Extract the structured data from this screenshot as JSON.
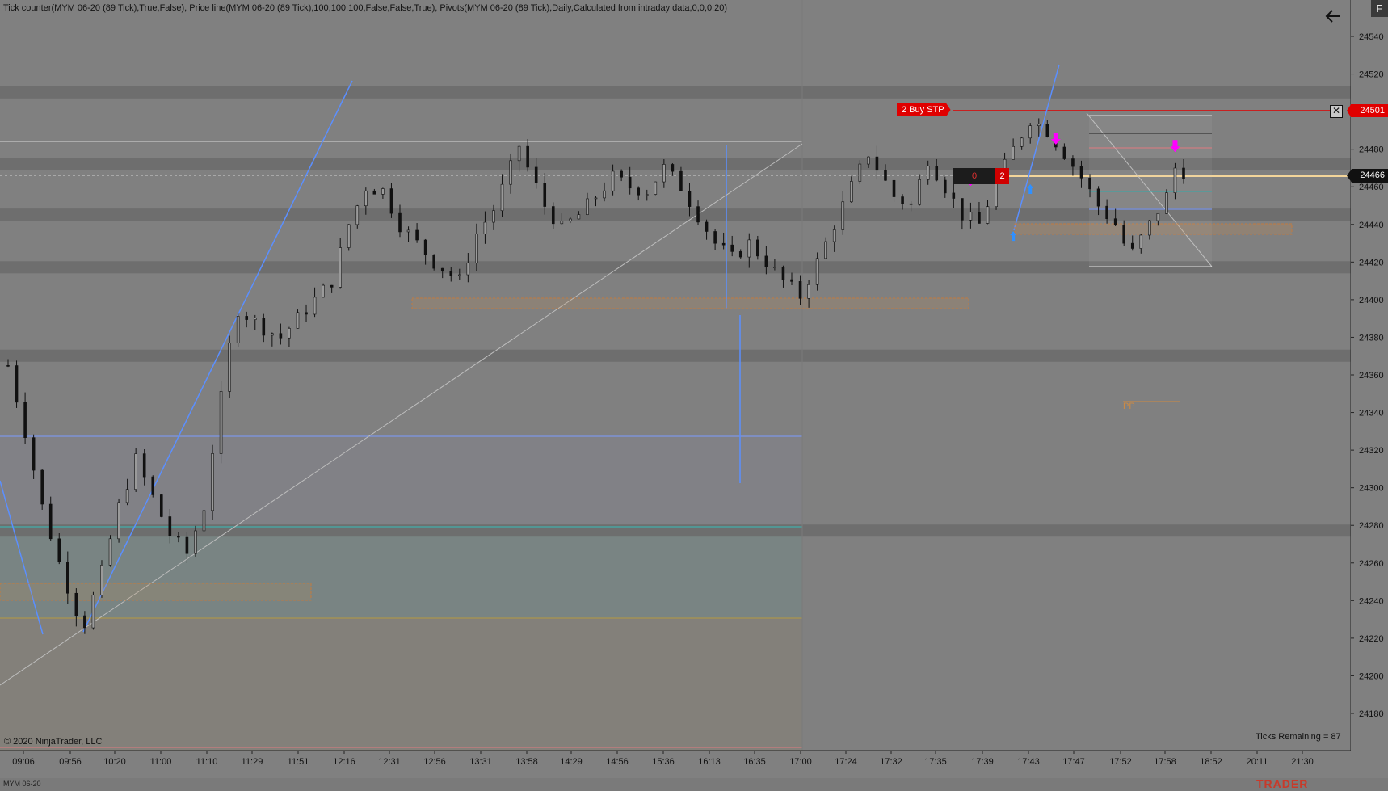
{
  "indicator_text": "Tick counter(MYM 06-20 (89 Tick),True,False), Price line(MYM 06-20 (89 Tick),100,100,100,False,False,True), Pivots(MYM 06-20 (89 Tick),Daily,Calculated from intraday data,0,0,0,20)",
  "f_button": "F",
  "copyright": "© 2020 NinjaTrader, LLC",
  "ticks_remaining": "Ticks Remaining = 87",
  "instrument_label": "MYM 06-20",
  "brand": "TRADER",
  "icons": {
    "back": "back-arrow-icon",
    "close": "close-x-icon"
  },
  "order": {
    "buy_stp_label": "2  Buy STP",
    "buy_stp_price": "24501",
    "position_left": "0",
    "position_qty": "2",
    "last_price": "24466"
  },
  "pivot_label": "PP",
  "colors": {
    "background": "#808080",
    "band_dark": "#6c6c6c",
    "buy_stop": "#e00000",
    "trend_line": "#5b8fff",
    "last_price_line": "#f3d59a",
    "pivot": "#d08a40",
    "signal_magenta": "#ff00ff",
    "signal_blue": "#3090ff"
  },
  "chart_data": {
    "type": "candlestick",
    "ylim": [
      24170,
      24550
    ],
    "y_ticks": [
      24540,
      24520,
      24500,
      24480,
      24460,
      24440,
      24420,
      24400,
      24380,
      24360,
      24340,
      24320,
      24300,
      24280,
      24260,
      24240,
      24220,
      24200,
      24180
    ],
    "x_ticks": [
      "09:06",
      "09:56",
      "10:20",
      "11:00",
      "11:10",
      "11:29",
      "11:51",
      "12:16",
      "12:31",
      "12:56",
      "13:31",
      "13:58",
      "14:29",
      "14:56",
      "15:36",
      "16:13",
      "16:35",
      "17:00",
      "17:24",
      "17:32",
      "17:35",
      "17:39",
      "17:43",
      "17:47",
      "17:52",
      "17:58",
      "18:52",
      "20:11",
      "21:30"
    ],
    "grid": false,
    "price_path": [
      [
        0,
        24365
      ],
      [
        2,
        24330
      ],
      [
        4,
        24290
      ],
      [
        6,
        24260
      ],
      [
        8,
        24235
      ],
      [
        9,
        24228
      ],
      [
        11,
        24255
      ],
      [
        13,
        24290
      ],
      [
        15,
        24315
      ],
      [
        17,
        24295
      ],
      [
        19,
        24275
      ],
      [
        21,
        24265
      ],
      [
        23,
        24290
      ],
      [
        24,
        24320
      ],
      [
        26,
        24375
      ],
      [
        27,
        24395
      ],
      [
        30,
        24385
      ],
      [
        32,
        24380
      ],
      [
        34,
        24390
      ],
      [
        36,
        24400
      ],
      [
        38,
        24410
      ],
      [
        40,
        24440
      ],
      [
        42,
        24460
      ],
      [
        44,
        24458
      ],
      [
        46,
        24440
      ],
      [
        48,
        24430
      ],
      [
        50,
        24420
      ],
      [
        53,
        24410
      ],
      [
        55,
        24435
      ],
      [
        57,
        24448
      ],
      [
        59,
        24470
      ],
      [
        60,
        24482
      ],
      [
        61,
        24470
      ],
      [
        63,
        24450
      ],
      [
        65,
        24438
      ],
      [
        67,
        24445
      ],
      [
        69,
        24455
      ],
      [
        71,
        24465
      ],
      [
        73,
        24460
      ],
      [
        75,
        24458
      ],
      [
        77,
        24470
      ],
      [
        79,
        24460
      ],
      [
        81,
        24445
      ],
      [
        83,
        24430
      ],
      [
        85,
        24422
      ],
      [
        87,
        24430
      ],
      [
        89,
        24420
      ],
      [
        91,
        24410
      ],
      [
        93,
        24402
      ],
      [
        95,
        24420
      ],
      [
        97,
        24440
      ],
      [
        99,
        24460
      ],
      [
        101,
        24478
      ],
      [
        102,
        24470
      ],
      [
        104,
        24455
      ],
      [
        106,
        24450
      ],
      [
        108,
        24475
      ],
      [
        110,
        24460
      ],
      [
        112,
        24445
      ],
      [
        114,
        24440
      ],
      [
        116,
        24462
      ],
      [
        118,
        24480
      ],
      [
        120,
        24496
      ],
      [
        122,
        24490
      ],
      [
        124,
        24478
      ],
      [
        126,
        24465
      ],
      [
        128,
        24450
      ],
      [
        130,
        24440
      ],
      [
        131,
        24430
      ],
      [
        132,
        24425
      ],
      [
        134,
        24440
      ],
      [
        136,
        24455
      ],
      [
        137,
        24470
      ],
      [
        138,
        24468
      ]
    ],
    "support_resistance_bands": [
      24510,
      24472,
      24445,
      24417,
      24370,
      24277
    ],
    "signals": {
      "sell": [
        [
          113,
          24454
        ],
        [
          123,
          24476
        ],
        [
          137,
          24472
        ]
      ],
      "buy": [
        [
          120,
          24470
        ],
        [
          118,
          24445
        ]
      ]
    }
  }
}
